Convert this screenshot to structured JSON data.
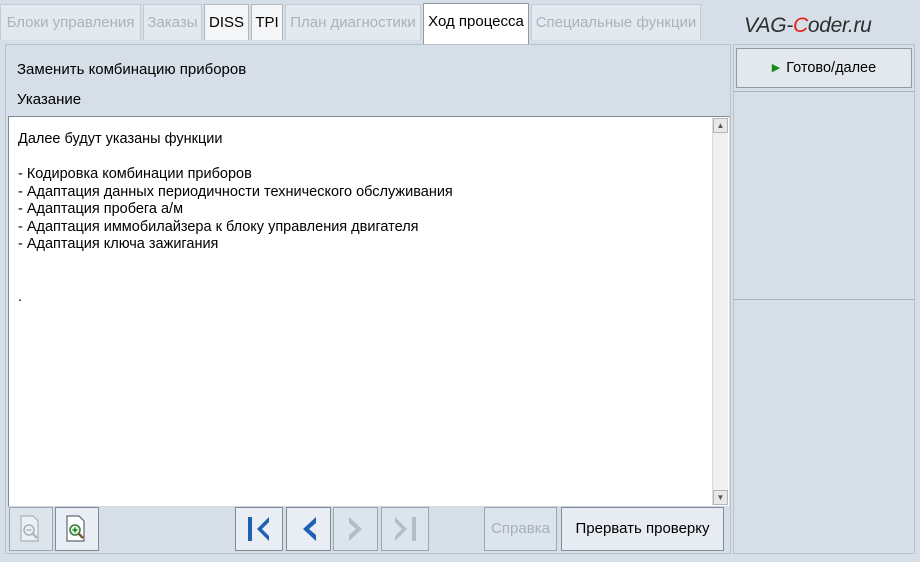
{
  "tabs": [
    {
      "label": "Блоки управления",
      "state": "disabled"
    },
    {
      "label": "Заказы",
      "state": "disabled"
    },
    {
      "label": "DISS",
      "state": "enabled"
    },
    {
      "label": "TPI",
      "state": "enabled"
    },
    {
      "label": "План диагностики",
      "state": "disabled"
    },
    {
      "label": "Ход процесса",
      "state": "active"
    },
    {
      "label": "Специальные функции",
      "state": "disabled"
    }
  ],
  "logo": {
    "part1": "VAG-",
    "accent": "C",
    "part2": "oder.ru",
    "accent_color": "#e32119"
  },
  "header": {
    "title": "Заменить комбинацию приборов",
    "subtitle": "Указание"
  },
  "content": {
    "lines": [
      "Далее будут указаны функции",
      "",
      "- Кодировка комбинации приборов",
      "- Адаптация данных периодичности технического обслуживания",
      "- Адаптация пробега а/м",
      "- Адаптация иммобилайзера к блоку управления двигателя",
      "- Адаптация ключа зажигания",
      "",
      "",
      "."
    ]
  },
  "toolbar": {
    "zoom_out_icon": "magnifier-minus-document-icon",
    "zoom_in_icon": "magnifier-plus-document-icon",
    "first_icon": "skip-to-first-icon",
    "prev_icon": "chevron-left-icon",
    "next_icon": "chevron-right-icon",
    "last_icon": "skip-to-last-icon",
    "help_label": "Справка",
    "abort_label": "Прервать проверку"
  },
  "right_panel": {
    "ready_label": "Готово/далее",
    "ready_icon": "play-triangle-icon"
  },
  "colors": {
    "nav_active": "#1f5fb4",
    "nav_disabled": "#b4bcc4",
    "ready_triangle": "#1a8a18",
    "background": "#d6dfe8"
  }
}
